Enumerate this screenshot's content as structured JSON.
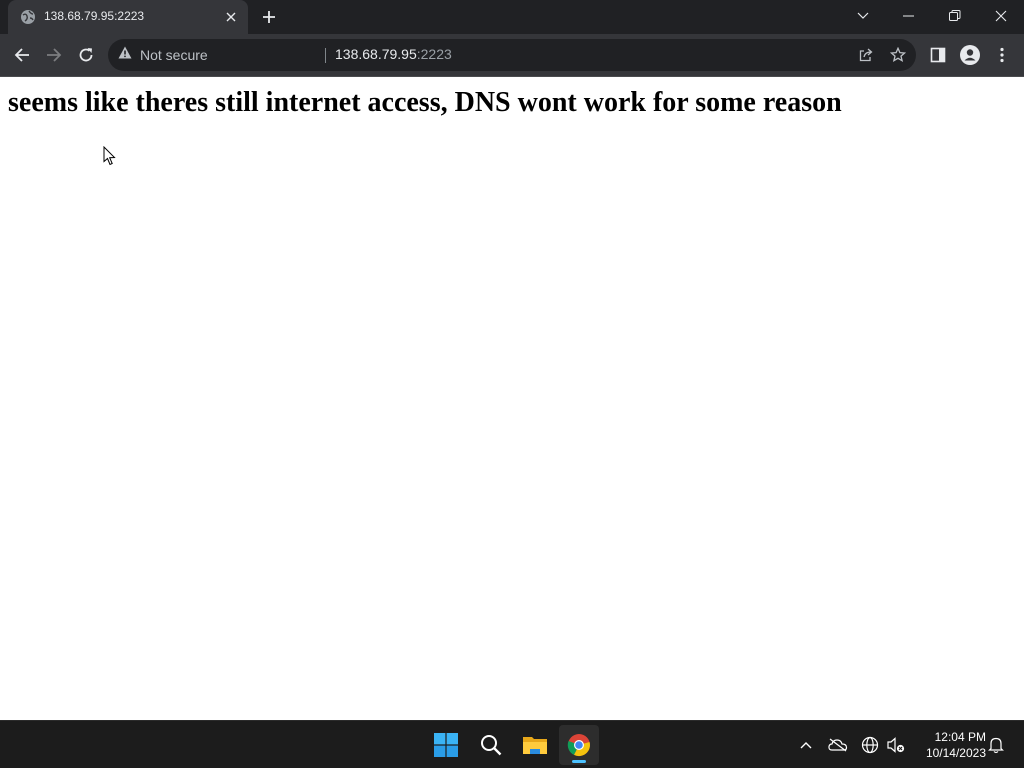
{
  "browser": {
    "tab": {
      "title": "138.68.79.95:2223"
    },
    "omnibox": {
      "security_label": "Not secure",
      "url_host": "138.68.79.95",
      "url_port": ":2223"
    },
    "icons": [
      "globe-icon",
      "close-icon",
      "plus-icon",
      "chevron-down-icon",
      "minimize-icon",
      "restore-icon",
      "back-icon",
      "forward-icon",
      "reload-icon",
      "warning-icon",
      "share-icon",
      "star-icon",
      "side-panel-icon",
      "profile-icon",
      "kebab-menu-icon"
    ]
  },
  "page": {
    "heading": "seems like theres still internet access, DNS wont work for some reason"
  },
  "taskbar": {
    "apps": [
      "start-icon",
      "search-icon",
      "file-explorer-icon",
      "chrome-icon"
    ],
    "tray": [
      "chevron-up-icon",
      "onedrive-icon",
      "language-icon",
      "network-volume-icon",
      "notification-bell-icon"
    ],
    "clock": {
      "time": "12:04 PM",
      "date": "10/14/2023"
    }
  },
  "colors": {
    "tabstrip_bg": "#202124",
    "toolbar_bg": "#35363a",
    "omnibox_bg": "#202124",
    "taskbar_bg": "#1c1c1c",
    "accent": "#4cc2ff"
  }
}
